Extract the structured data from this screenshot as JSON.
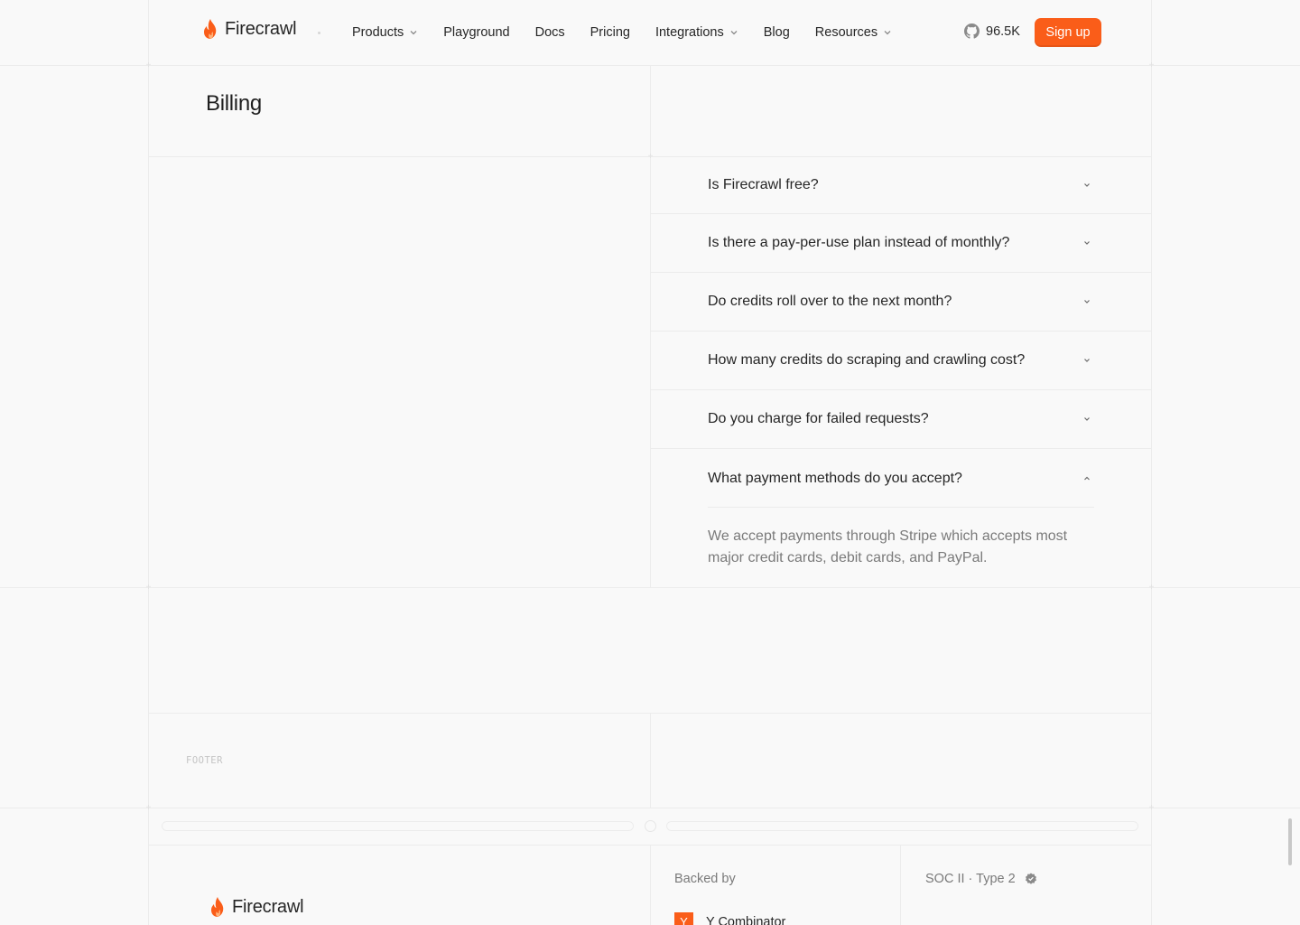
{
  "nav": {
    "brand": "Firecrawl",
    "items": [
      {
        "label": "Products",
        "dropdown": true
      },
      {
        "label": "Playground",
        "dropdown": false
      },
      {
        "label": "Docs",
        "dropdown": false
      },
      {
        "label": "Pricing",
        "dropdown": false
      },
      {
        "label": "Integrations",
        "dropdown": true
      },
      {
        "label": "Blog",
        "dropdown": false
      },
      {
        "label": "Resources",
        "dropdown": true
      }
    ],
    "github_stars": "96.5K",
    "signup_label": "Sign up"
  },
  "section": {
    "title": "Billing"
  },
  "faq": {
    "questions": [
      {
        "q": "Is Firecrawl free?",
        "open": false
      },
      {
        "q": "Is there a pay-per-use plan instead of monthly?",
        "open": false
      },
      {
        "q": "Do credits roll over to the next month?",
        "open": false
      },
      {
        "q": "How many credits do scraping and crawling cost?",
        "open": false
      },
      {
        "q": "Do you charge for failed requests?",
        "open": false
      },
      {
        "q": "What payment methods do you accept?",
        "open": true
      }
    ],
    "answer": "We accept payments through Stripe which accepts most major credit cards, debit cards, and PayPal."
  },
  "footer": {
    "label": "FOOTER",
    "brand": "Firecrawl",
    "backed_by": "Backed by",
    "yc_letter": "Y",
    "yc_name": "Y Combinator",
    "soc": "SOC II · Type 2"
  },
  "colors": {
    "accent": "#fa5d19",
    "border": "#ececec",
    "text": "#262626",
    "muted": "#7a7a7a"
  }
}
